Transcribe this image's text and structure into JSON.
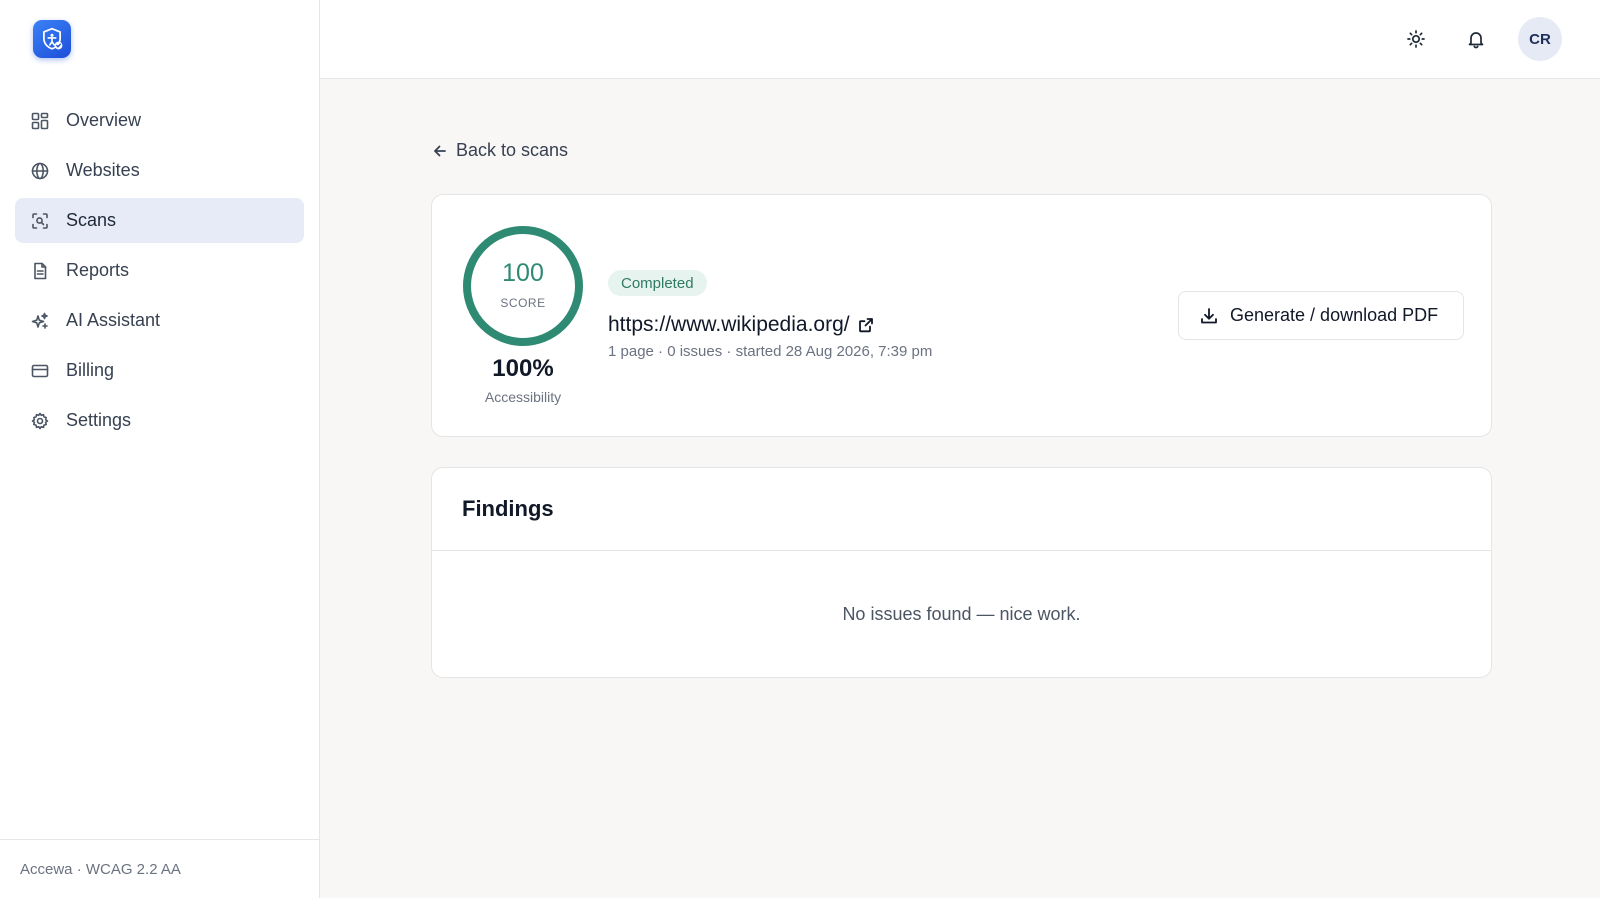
{
  "app": {
    "brand": "Accewa",
    "footer": "Accewa · WCAG 2.2 AA",
    "accent": "#2f8a73"
  },
  "sidebar": {
    "items": [
      {
        "label": "Overview",
        "icon": "grid-icon"
      },
      {
        "label": "Websites",
        "icon": "globe-icon"
      },
      {
        "label": "Scans",
        "icon": "scan-icon",
        "active": true
      },
      {
        "label": "Reports",
        "icon": "document-icon"
      },
      {
        "label": "AI Assistant",
        "icon": "sparkles-icon"
      },
      {
        "label": "Billing",
        "icon": "credit-card-icon"
      },
      {
        "label": "Settings",
        "icon": "gear-icon"
      }
    ]
  },
  "header": {
    "avatar_initials": "CR",
    "icons": [
      "sun-icon",
      "bell-icon"
    ]
  },
  "main": {
    "back_label": "Back to scans",
    "score": {
      "value": "100",
      "label": "SCORE",
      "fraction": 1.0,
      "percent": "100%",
      "category": "Accessibility"
    },
    "status": "Completed",
    "url": "https://www.wikipedia.org/",
    "meta": "1 page · 0 issues · started 28 Aug 2026, 7:39 pm",
    "pdf_button": "Generate / download PDF",
    "findings": {
      "title": "Findings",
      "empty_message": "No issues found — nice work."
    }
  }
}
